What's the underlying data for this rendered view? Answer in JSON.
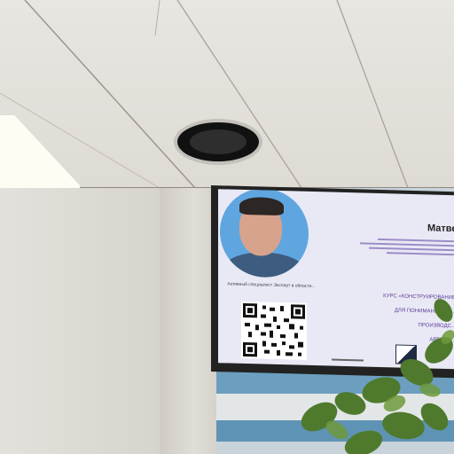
{
  "screen": {
    "name": "Матвей",
    "caption": "Активный специалист\nЭксперт в области...",
    "course_line1": "КУРС «КОНСТРУИРОВАНИЕ",
    "course_line2": "ДЛЯ ПОНИМАНИЯ СО...",
    "course_line3": "ПРОИЗВОДС...",
    "course_line4": "АВТОМА..."
  },
  "colors": {
    "screen_bg": "#e9e9f5",
    "accent": "#5a3c9a",
    "photo_bg": "#5fa6e0"
  }
}
